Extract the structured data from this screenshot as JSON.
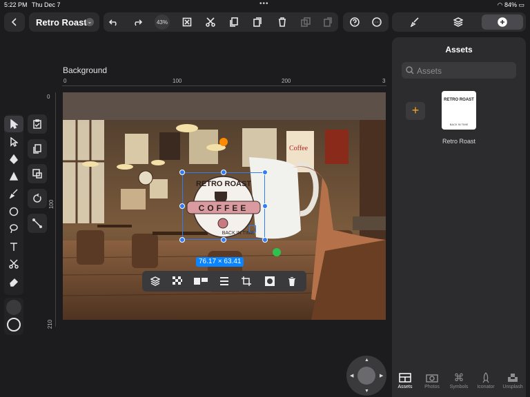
{
  "status": {
    "time": "5:22 PM",
    "date": "Thu Dec 7",
    "battery": "84%"
  },
  "document": {
    "title": "Retro Roast",
    "zoom": "43%"
  },
  "canvas": {
    "layer_label": "Background",
    "ruler_x": [
      "0",
      "100",
      "200",
      "3"
    ],
    "ruler_y": [
      "0",
      "100",
      "210"
    ],
    "selection_size": "76.17 × 63.41"
  },
  "artwork": {
    "brand": "RETRO ROAST",
    "badge": "COFFEE",
    "tagline": "BACK IN TIME",
    "sign": "Coffee"
  },
  "panel": {
    "title": "Assets",
    "search_placeholder": "Assets",
    "add_label": "+",
    "asset": {
      "name": "Retro Roast"
    },
    "tabs": [
      {
        "label": "Assets",
        "icon": "assets-icon"
      },
      {
        "label": "Photos",
        "icon": "camera-icon"
      },
      {
        "label": "Symbols",
        "icon": "command-icon"
      },
      {
        "label": "Iconator",
        "icon": "rocket-icon"
      },
      {
        "label": "Unsplash",
        "icon": "unsplash-icon"
      }
    ]
  },
  "colors": {
    "accent": "#0a84ff",
    "add": "#f5a623",
    "handle": "#2f7cf6"
  }
}
